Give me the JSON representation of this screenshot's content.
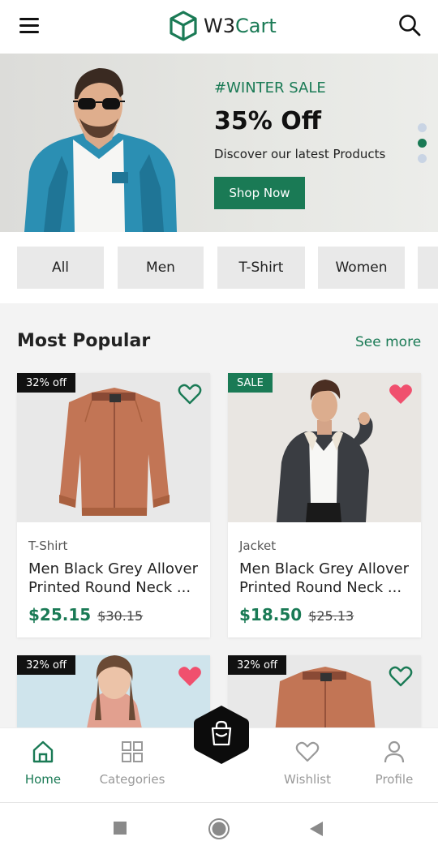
{
  "header": {
    "logo_prefix": "W3",
    "logo_suffix": "Cart",
    "menu_icon": "hamburger-menu-icon",
    "search_icon": "search-icon"
  },
  "banner": {
    "tag": "#WINTER SALE",
    "title": "35% Off",
    "subtitle": "Discover our latest Products",
    "button": "Shop Now",
    "slides": 3,
    "active_slide": 2
  },
  "categories": [
    "All",
    "Men",
    "T-Shirt",
    "Women"
  ],
  "section": {
    "title": "Most Popular",
    "see_more": "See more"
  },
  "products": [
    {
      "badge": "32% off",
      "category": "T-Shirt",
      "name_line1": "Men Black Grey Allover",
      "name_line2": "Printed Round Neck ...",
      "price": "$25.15",
      "old_price": "$30.15",
      "favorite": false
    },
    {
      "badge": "SALE",
      "category": "Jacket",
      "name_line1": "Men Black Grey Allover",
      "name_line2": "Printed Round Neck ...",
      "price": "$18.50",
      "old_price": "$25.13",
      "favorite": true
    },
    {
      "badge": "32% off",
      "favorite": true
    },
    {
      "badge": "32% off",
      "favorite": false
    }
  ],
  "nav": {
    "home": "Home",
    "categories": "Categories",
    "wishlist": "Wishlist",
    "profile": "Profile",
    "active": "Home",
    "cart_icon": "shopping-bag-icon"
  },
  "colors": {
    "brand": "#1a7a55",
    "heart_active": "#f0506e"
  }
}
